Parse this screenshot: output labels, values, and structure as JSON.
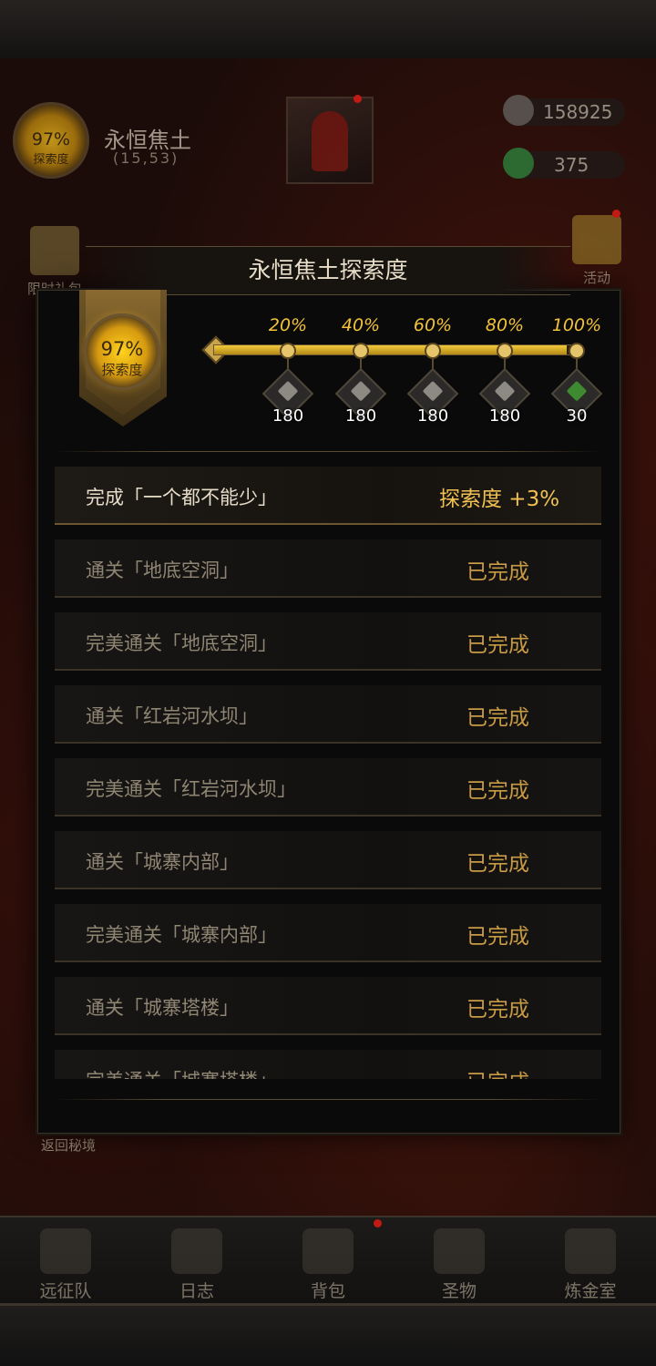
{
  "hud": {
    "exploration_pct": "97%",
    "exploration_label": "探索度",
    "location_name": "永恒焦土",
    "coords": "(15,53)",
    "currency1": "158925",
    "currency2": "375",
    "limited_gift": "限时礼包",
    "activity": "活动",
    "return_label": "返回秘境"
  },
  "modal": {
    "title": "永恒焦土探索度",
    "badge_pct": "97%",
    "badge_label": "探索度",
    "progress_fraction": 0.97,
    "milestones": [
      {
        "pct": "20%",
        "qty": "180",
        "claimed": true
      },
      {
        "pct": "40%",
        "qty": "180",
        "claimed": true
      },
      {
        "pct": "60%",
        "qty": "180",
        "claimed": true
      },
      {
        "pct": "80%",
        "qty": "180",
        "claimed": true
      },
      {
        "pct": "100%",
        "qty": "30",
        "claimed": false
      }
    ],
    "tasks": [
      {
        "name": "完成「一个都不能少」",
        "status": "探索度 +3%"
      },
      {
        "name": "通关「地底空洞」",
        "status": "已完成"
      },
      {
        "name": "完美通关「地底空洞」",
        "status": "已完成"
      },
      {
        "name": "通关「红岩河水坝」",
        "status": "已完成"
      },
      {
        "name": "完美通关「红岩河水坝」",
        "status": "已完成"
      },
      {
        "name": "通关「城寨内部」",
        "status": "已完成"
      },
      {
        "name": "完美通关「城寨内部」",
        "status": "已完成"
      },
      {
        "name": "通关「城寨塔楼」",
        "status": "已完成"
      },
      {
        "name": "完美通关「城寨塔楼」",
        "status": "已完成"
      }
    ]
  },
  "nav": {
    "items": [
      {
        "label": "远征队",
        "icon": "helmet-icon"
      },
      {
        "label": "日志",
        "icon": "scroll-icon"
      },
      {
        "label": "背包",
        "icon": "backpack-icon"
      },
      {
        "label": "圣物",
        "icon": "chalice-icon"
      },
      {
        "label": "炼金室",
        "icon": "alchemy-icon"
      }
    ]
  },
  "colors": {
    "gold": "#f2c23a",
    "claimed_check": "#5ee04a",
    "completed_text": "#c89a45"
  }
}
